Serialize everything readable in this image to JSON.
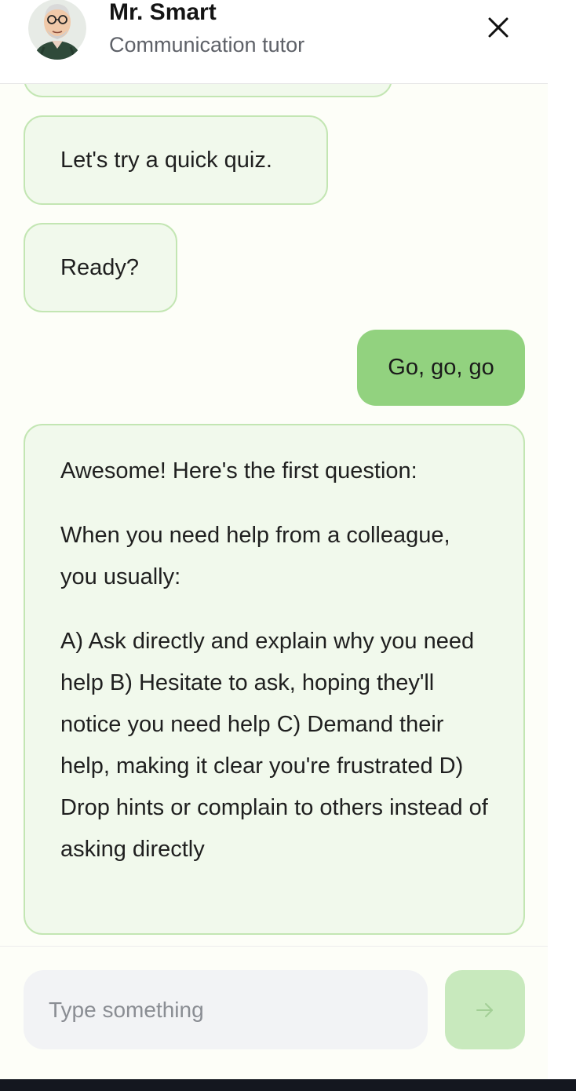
{
  "header": {
    "tutor_name": "Mr. Smart",
    "tutor_role": "Communication tutor",
    "close_icon": "close-icon"
  },
  "messages": [
    {
      "from": "tutor",
      "text": "Let's try a quick quiz."
    },
    {
      "from": "tutor",
      "text": "Ready?"
    },
    {
      "from": "user",
      "text": "Go, go, go"
    },
    {
      "from": "tutor",
      "paragraphs": [
        "Awesome! Here's the first question:",
        "When you need help from a colleague, you usually:",
        "A) Ask directly and explain why you need help B) Hesitate to ask, hoping they'll notice you need help C) Demand their help, making it clear you're frustrated D) Drop hints or complain to others instead of asking directly"
      ]
    }
  ],
  "composer": {
    "placeholder": "Type something",
    "value": "",
    "send_icon": "arrow-right-icon"
  },
  "colors": {
    "tutor_bubble_bg": "#f1f9ec",
    "tutor_bubble_border": "#c3e6b3",
    "user_bubble_bg": "#92d27f",
    "send_button_bg": "#c8e9bd"
  }
}
